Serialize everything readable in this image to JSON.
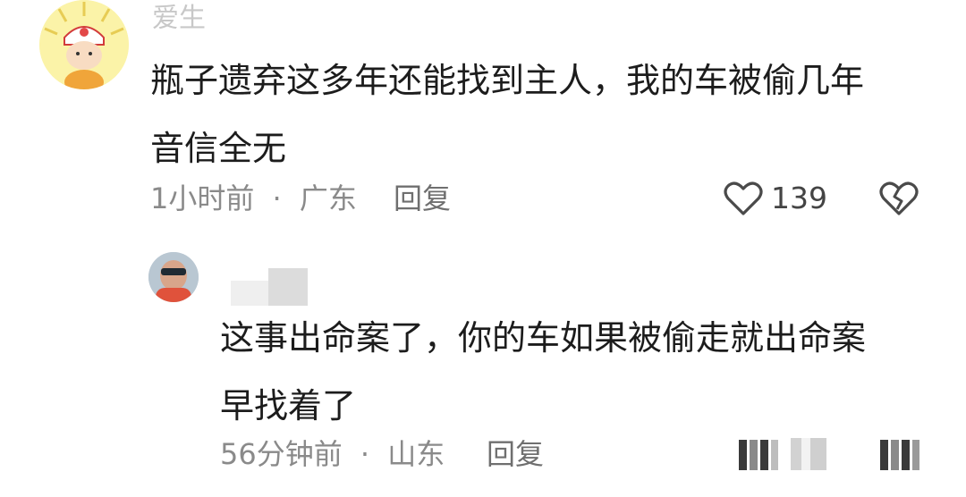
{
  "comments": [
    {
      "username": "爱生",
      "text_line1": "瓶子遗弃这多年还能找到主人，我的车被偷几年",
      "text_line2": "音信全无",
      "time": "1小时前",
      "separator": "·",
      "location": "广东",
      "reply_label": "回复",
      "like_count": "139"
    },
    {
      "username": "",
      "text_line1": "这事出命案了，你的车如果被偷走就出命案",
      "text_line2": "早找着了",
      "time": "56分钟前",
      "separator": "·",
      "location": "山东",
      "reply_label": "回复"
    }
  ],
  "icons": {
    "like": "heart-outline-icon",
    "dislike": "broken-heart-icon"
  }
}
